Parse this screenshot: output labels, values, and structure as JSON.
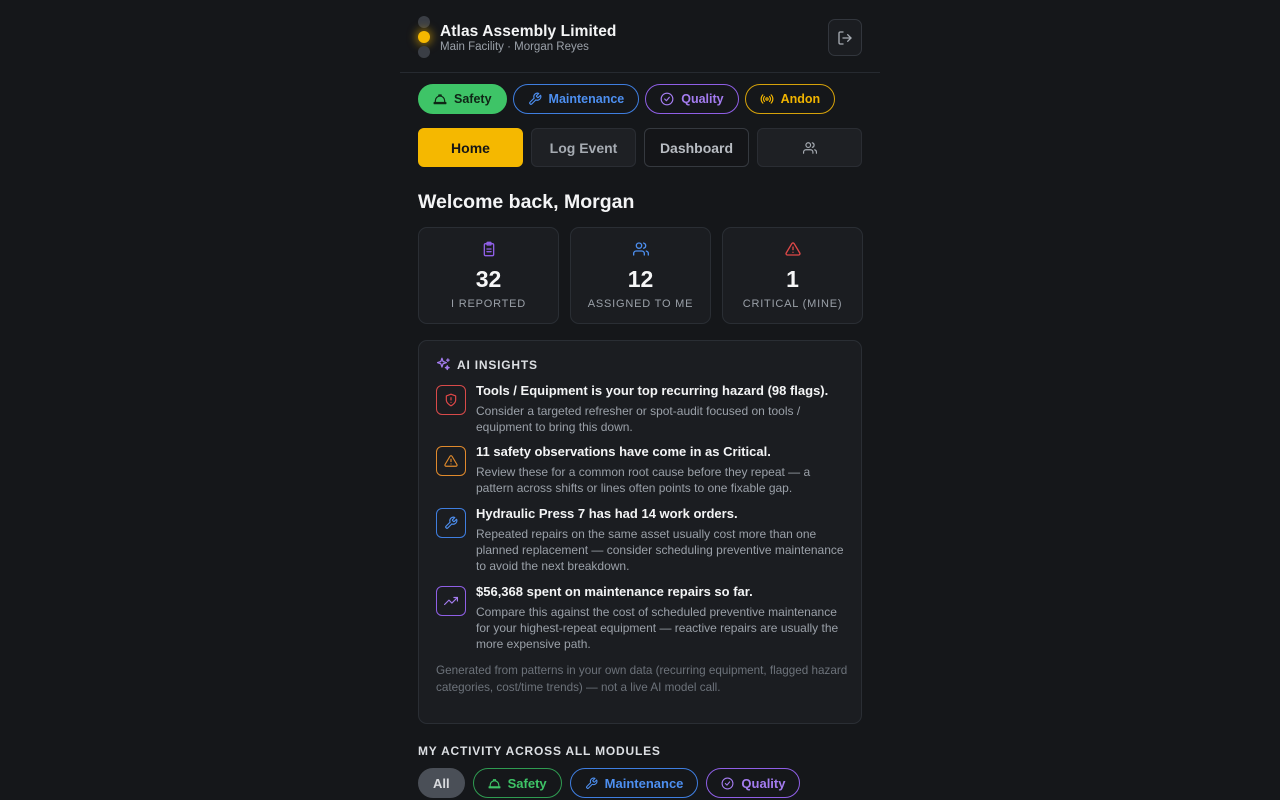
{
  "header": {
    "company": "Atlas Assembly Limited",
    "subtitle": "Main Facility · Morgan Reyes"
  },
  "modules": [
    {
      "label": "Safety",
      "icon": "hardhat-icon"
    },
    {
      "label": "Maintenance",
      "icon": "wrench-icon"
    },
    {
      "label": "Quality",
      "icon": "check-circle-icon"
    },
    {
      "label": "Andon",
      "icon": "broadcast-icon"
    }
  ],
  "tabs": {
    "home": "Home",
    "log_event": "Log Event",
    "dashboard": "Dashboard",
    "team_icon": "users-icon"
  },
  "welcome": "Welcome back, Morgan",
  "stats": [
    {
      "value": "32",
      "label": "I REPORTED",
      "icon": "clipboard-icon",
      "color": "#8f5fe6"
    },
    {
      "value": "12",
      "label": "ASSIGNED TO ME",
      "icon": "users-icon",
      "color": "#4d8ff0"
    },
    {
      "value": "1",
      "label": "CRITICAL (MINE)",
      "icon": "warning-icon",
      "color": "#e04848"
    }
  ],
  "insights": {
    "heading": "AI INSIGHTS",
    "items": [
      {
        "title": "Tools / Equipment is your top recurring hazard (98 flags).",
        "desc": "Consider a targeted refresher or spot-audit focused on tools / equipment to bring this down.",
        "icon": "shield-alert-icon"
      },
      {
        "title": "11 safety observations have come in as Critical.",
        "desc": "Review these for a common root cause before they repeat — a pattern across shifts or lines often points to one fixable gap.",
        "icon": "warning-icon"
      },
      {
        "title": "Hydraulic Press 7 has had 14 work orders.",
        "desc": "Repeated repairs on the same asset usually cost more than one planned replacement — consider scheduling preventive maintenance to avoid the next breakdown.",
        "icon": "wrench-icon"
      },
      {
        "title": "$56,368 spent on maintenance repairs so far.",
        "desc": "Compare this against the cost of scheduled preventive maintenance for your highest-repeat equipment — reactive repairs are usually the more expensive path.",
        "icon": "trending-up-icon"
      }
    ],
    "footnote": "Generated from patterns in your own data (recurring equipment, flagged hazard categories, cost/time trends) — not a live AI model call."
  },
  "activity": {
    "title": "MY ACTIVITY ACROSS ALL MODULES",
    "filters": [
      "All",
      "Safety",
      "Maintenance",
      "Quality"
    ]
  },
  "colors": {
    "accent": "#f5b800",
    "safety": "#3ec467",
    "maintenance": "#4d8ff0",
    "quality": "#a47cf0",
    "andon": "#f0b400",
    "background": "#15171a"
  }
}
